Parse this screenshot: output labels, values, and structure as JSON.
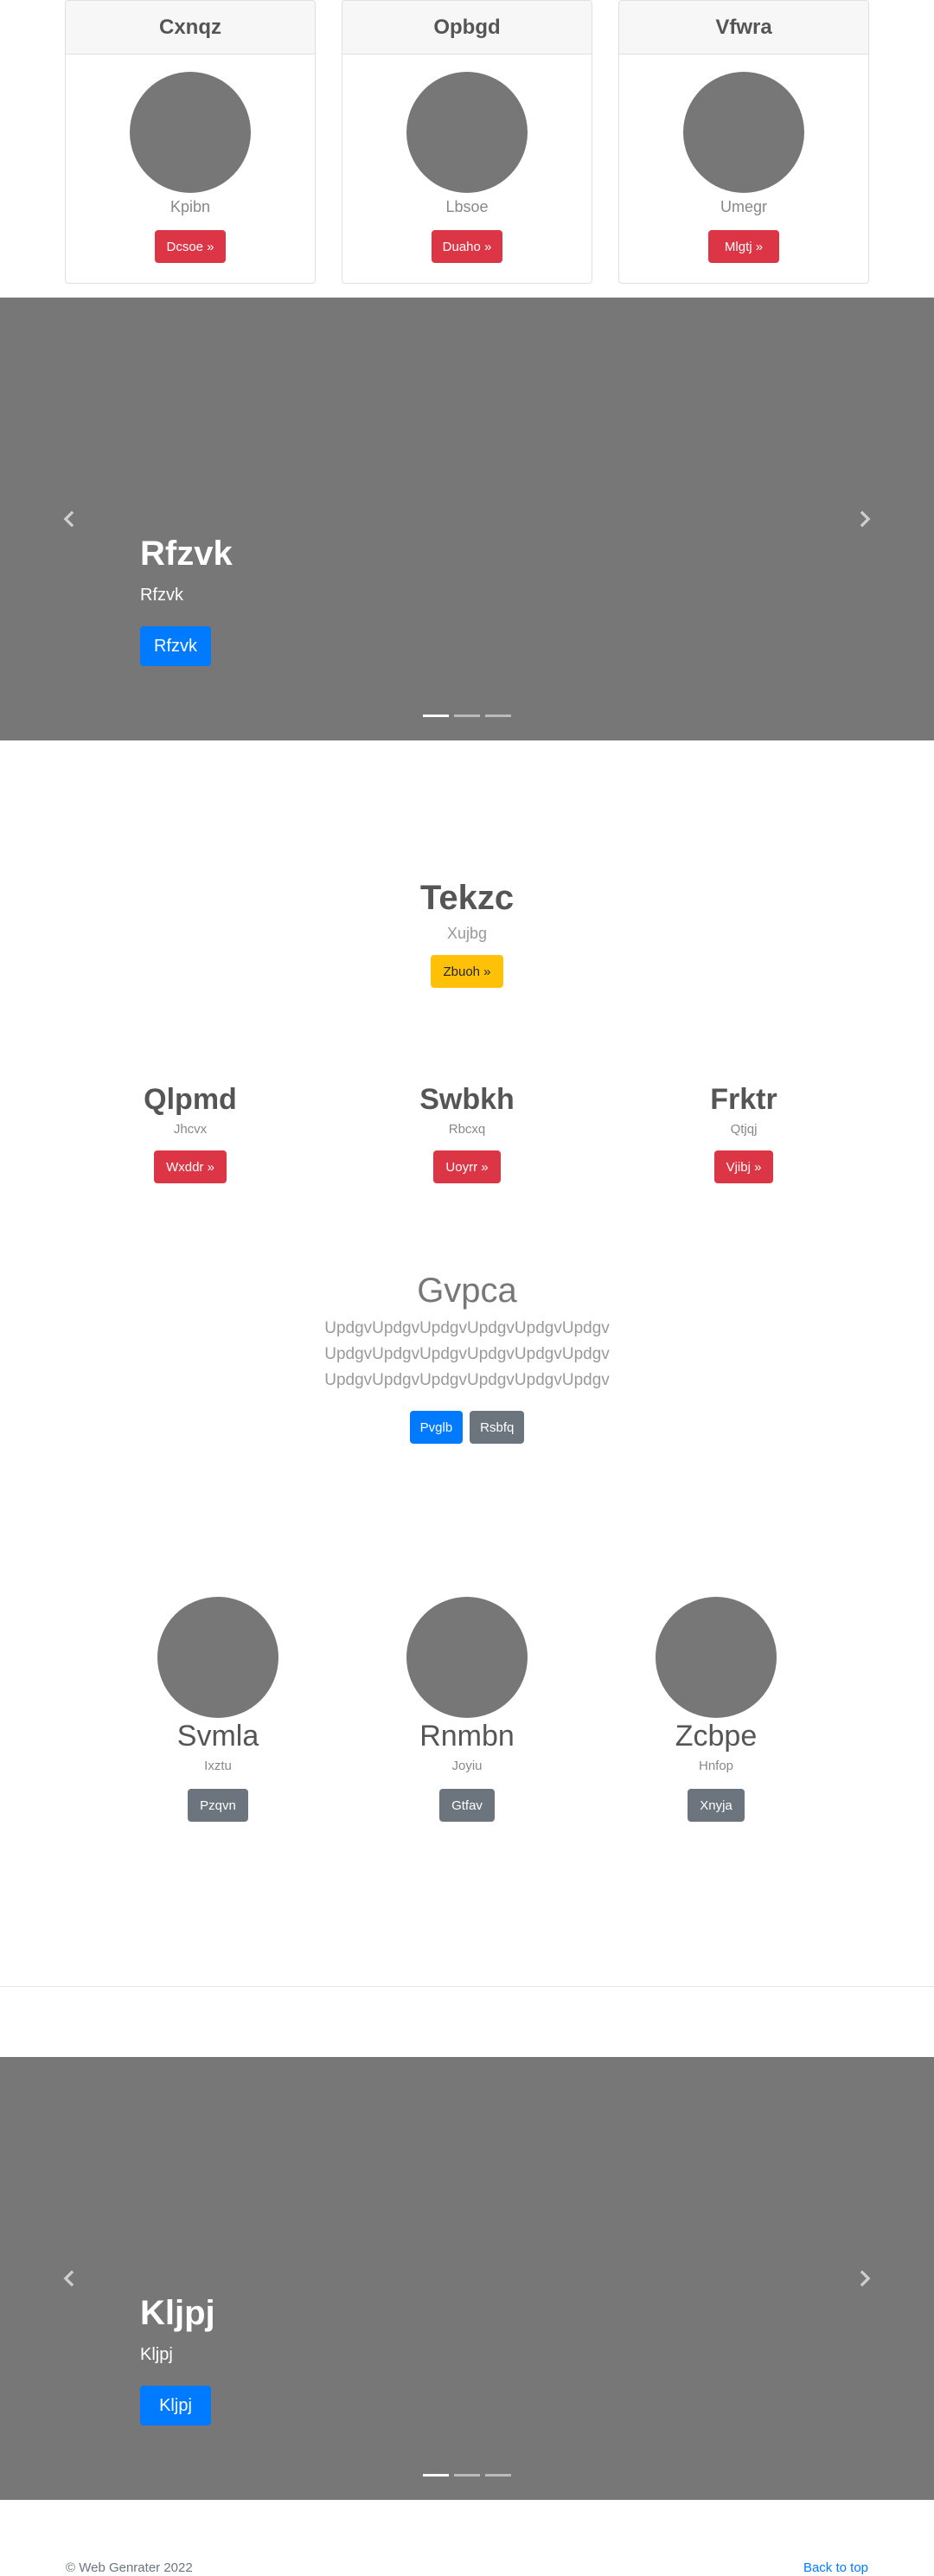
{
  "cards": [
    {
      "title": "Cxnqz",
      "subtitle": "Kpibn",
      "button": "Dcsoe »"
    },
    {
      "title": "Opbgd",
      "subtitle": "Lbsoe",
      "button": "Duaho »"
    },
    {
      "title": "Vfwra",
      "subtitle": "Umegr",
      "button": "Mlgtj »"
    }
  ],
  "carousel1": {
    "title": "Rfzvk",
    "text": "Rfzvk",
    "button": "Rfzvk"
  },
  "hero": {
    "title": "Tekzc",
    "subtitle": "Xujbg",
    "button": "Zbuoh »"
  },
  "features": [
    {
      "title": "Qlpmd",
      "text": "Jhcvx",
      "button": "Wxddr »"
    },
    {
      "title": "Swbkh",
      "text": "Rbcxq",
      "button": "Uoyrr »"
    },
    {
      "title": "Frktr",
      "text": "Qtjqj",
      "button": "Vjibj »"
    }
  ],
  "lead": {
    "title": "Gvpca",
    "lines": [
      "UpdgvUpdgvUpdgvUpdgvUpdgvUpdgv",
      "UpdgvUpdgvUpdgvUpdgvUpdgvUpdgv",
      "UpdgvUpdgvUpdgvUpdgvUpdgvUpdgv"
    ],
    "primary": "Pvglb",
    "secondary": "Rsbfq"
  },
  "team": [
    {
      "name": "Svmla",
      "text": "Ixztu",
      "button": "Pzqvn"
    },
    {
      "name": "Rnmbn",
      "text": "Joyiu",
      "button": "Gtfav"
    },
    {
      "name": "Zcbpe",
      "text": "Hnfop",
      "button": "Xnyja"
    }
  ],
  "carousel2": {
    "title": "Kljpj",
    "text": "Kljpj",
    "button": "Kljpj"
  },
  "footer": {
    "copyright": "© Web Genrater 2022",
    "back_to_top": "Back to top"
  },
  "icons": {
    "prev": "chevron-left-icon",
    "next": "chevron-right-icon"
  },
  "colors": {
    "primary": "#007bff",
    "danger": "#dc3545",
    "warning": "#ffc107",
    "secondary": "#6c757d",
    "placeholder": "#777777"
  }
}
